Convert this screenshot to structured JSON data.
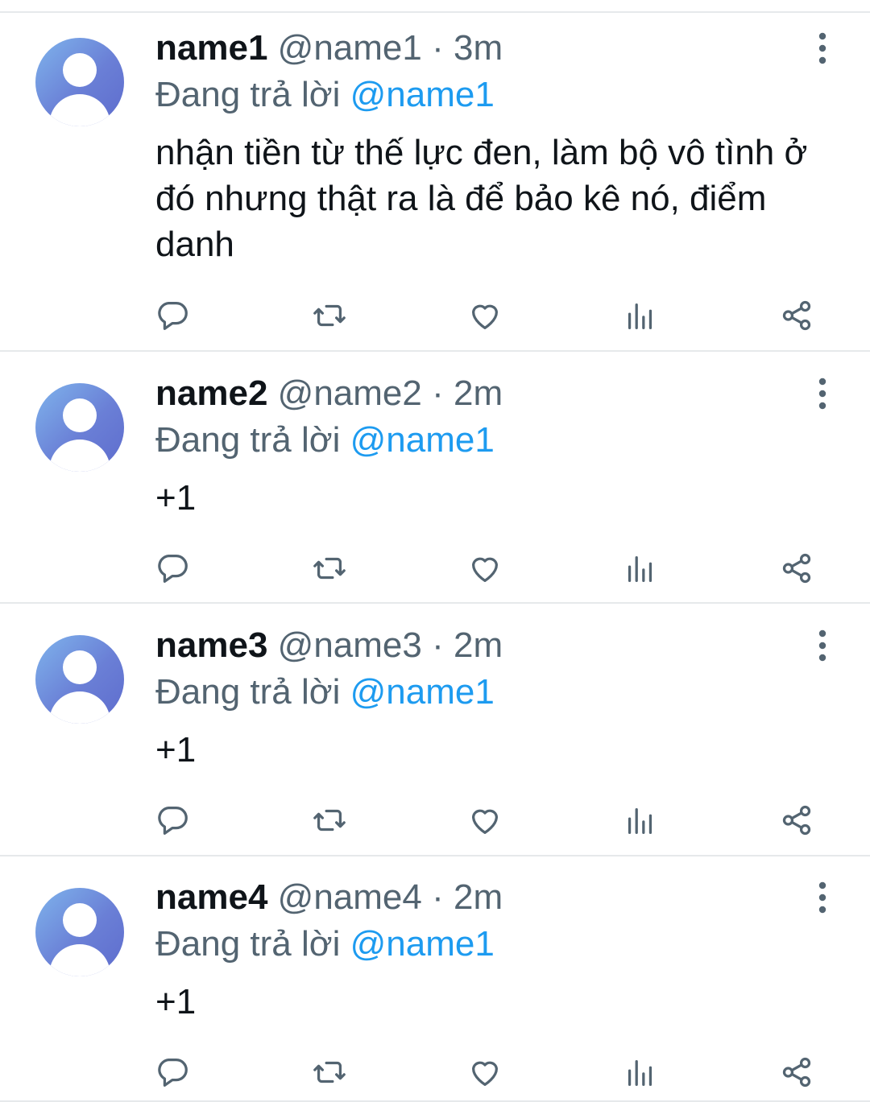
{
  "replying_prefix": "Đang trả lời",
  "tweets": [
    {
      "display_name": "name1",
      "handle": "@name1",
      "separator": "·",
      "time": "3m",
      "reply_to": "@name1",
      "text": "nhận tiền từ thế lực đen, làm bộ vô tình ở đó nhưng thật ra là để bảo kê nó, điểm danh"
    },
    {
      "display_name": "name2",
      "handle": "@name2",
      "separator": "·",
      "time": "2m",
      "reply_to": "@name1",
      "text": "+1"
    },
    {
      "display_name": "name3",
      "handle": "@name3",
      "separator": "·",
      "time": "2m",
      "reply_to": "@name1",
      "text": "+1"
    },
    {
      "display_name": "name4",
      "handle": "@name4",
      "separator": "·",
      "time": "2m",
      "reply_to": "@name1",
      "text": "+1"
    }
  ],
  "icons": {
    "more": "more-vertical-icon",
    "reply": "reply-bubble-icon",
    "retweet": "retweet-icon",
    "like": "heart-icon",
    "views": "views-bars-icon",
    "share": "share-icon"
  },
  "colors": {
    "primary_text": "#0f1419",
    "secondary_text": "#536471",
    "mention": "#1d9bf0",
    "divider": "#e6e9eb",
    "avatar_gradient_start": "#7fb4ec",
    "avatar_gradient_end": "#5e6ccd"
  }
}
